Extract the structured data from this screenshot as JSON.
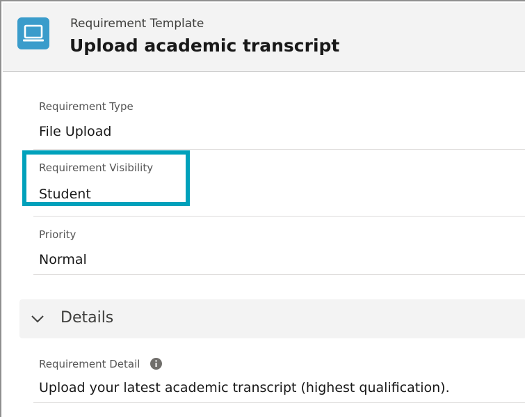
{
  "header": {
    "icon": "laptop-icon",
    "object_label": "Requirement Template",
    "record_title": "Upload academic transcript"
  },
  "fields": {
    "requirement_type": {
      "label": "Requirement Type",
      "value": "File Upload"
    },
    "requirement_visibility": {
      "label": "Requirement Visibility",
      "value": "Student"
    },
    "priority": {
      "label": "Priority",
      "value": "Normal"
    }
  },
  "details_section": {
    "title": "Details",
    "expanded": true,
    "requirement_detail": {
      "label": "Requirement Detail",
      "info_icon": "info-icon",
      "value": "Upload your latest academic transcript (highest qualification)."
    }
  },
  "colors": {
    "header_bg": "#f3f3f3",
    "icon_bg": "#3a9ccb",
    "highlight": "#00a1bb"
  }
}
